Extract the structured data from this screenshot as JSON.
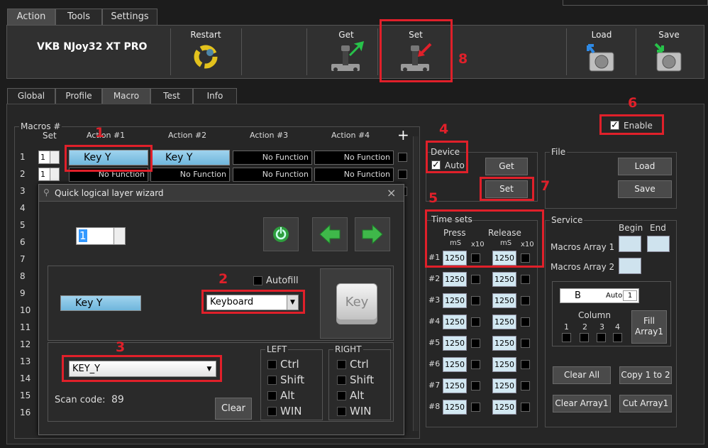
{
  "main_tabs": [
    "Action",
    "Tools",
    "Settings"
  ],
  "device_name": "VKB NJoy32 XT PRO",
  "ribbon": {
    "restart": "Restart",
    "get": "Get",
    "set": "Set",
    "load": "Load",
    "save": "Save"
  },
  "sub_tabs": [
    "Global",
    "Profile",
    "Macro",
    "Test",
    "Info"
  ],
  "macros": {
    "group_title": "Macros #",
    "col_set": "Set",
    "actions": [
      "Action #1",
      "Action #2",
      "Action #3",
      "Action #4"
    ],
    "add": "+",
    "rows": [
      "1",
      "2",
      "3",
      "4",
      "5",
      "6",
      "7",
      "8",
      "9",
      "10",
      "11",
      "12",
      "13",
      "14",
      "15",
      "16"
    ],
    "row1": {
      "set": "1",
      "cells": [
        "Key Y",
        "Key Y",
        "No Function",
        "No Function"
      ]
    },
    "row2": {
      "set": "1",
      "cells": [
        "No Function",
        "No Function",
        "No Function",
        "No Function"
      ]
    }
  },
  "wizard": {
    "title": "Quick logical layer wizard",
    "close": "×",
    "layer_value": "1",
    "key_display": "Key Y",
    "autofill_label": "Autofill",
    "type_select": "Keyboard",
    "key_icon": "Key",
    "key_select": "KEY_Y",
    "scan_label": "Scan code:",
    "scan_value": "89",
    "clear": "Clear",
    "left_title": "LEFT",
    "right_title": "RIGHT",
    "mods": [
      "Ctrl",
      "Shift",
      "Alt",
      "WIN"
    ]
  },
  "device_group": {
    "title": "Device",
    "auto": "Auto",
    "get": "Get",
    "set": "Set"
  },
  "file_group": {
    "title": "File",
    "load": "Load",
    "save": "Save"
  },
  "enable": "Enable",
  "timesets": {
    "title": "Time sets",
    "press": "Press",
    "release": "Release",
    "ms1": "mS",
    "ms2": "mS",
    "x10a": "x10",
    "x10b": "x10",
    "rows": [
      {
        "label": "#1",
        "press": "1250",
        "release": "1250"
      },
      {
        "label": "#2",
        "press": "1250",
        "release": "1250"
      },
      {
        "label": "#3",
        "press": "1250",
        "release": "1250"
      },
      {
        "label": "#4",
        "press": "1250",
        "release": "1250"
      },
      {
        "label": "#5",
        "press": "1250",
        "release": "1250"
      },
      {
        "label": "#6",
        "press": "1250",
        "release": "1250"
      },
      {
        "label": "#7",
        "press": "1250",
        "release": "1250"
      },
      {
        "label": "#8",
        "press": "1250",
        "release": "1250"
      }
    ]
  },
  "service": {
    "title": "Service",
    "begin": "Begin",
    "end": "End",
    "array1": "Macros Array 1",
    "array2": "Macros Array 2",
    "b_value": "B",
    "auto_label": "Auto",
    "auto_num": "1",
    "column": "Column",
    "cols": [
      "1",
      "2",
      "3",
      "4"
    ],
    "fill": "Fill",
    "fill2": "Array1",
    "clear_all": "Clear All",
    "copy": "Copy 1 to 2",
    "clear_array": "Clear Array1",
    "cut_array": "Cut Array1"
  },
  "annotations": [
    "1",
    "2",
    "3",
    "4",
    "5",
    "6",
    "7",
    "8"
  ],
  "colors": {
    "highlight": "#e0202a",
    "key_cell": "#7fc3e6",
    "input": "#d2e8f2"
  }
}
